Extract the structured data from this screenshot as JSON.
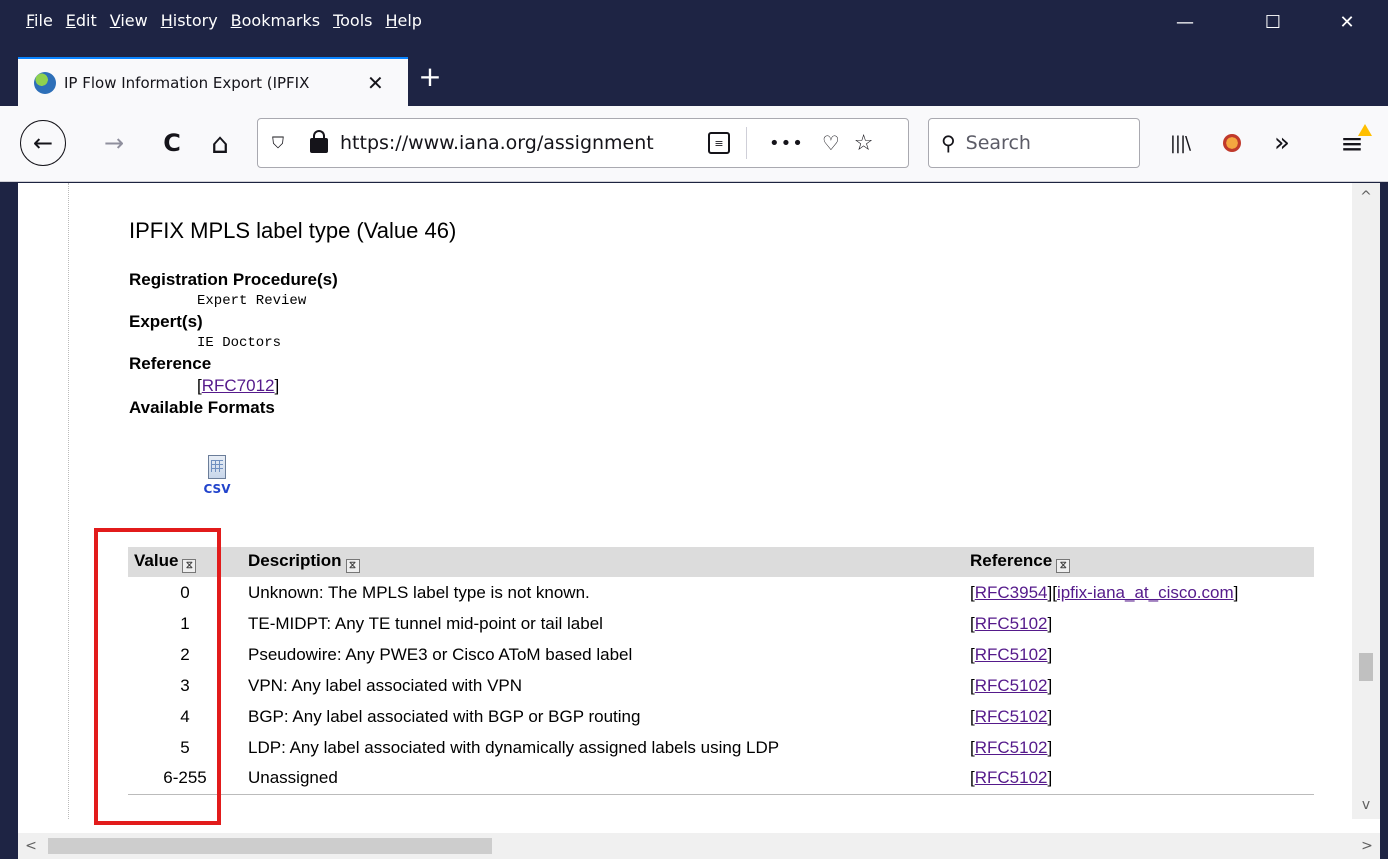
{
  "menubar": {
    "items": [
      "File",
      "Edit",
      "View",
      "History",
      "Bookmarks",
      "Tools",
      "Help"
    ],
    "minimize": "—",
    "maximize": "☐",
    "close": "✕"
  },
  "tab": {
    "title": "IP Flow Information Export (IPFIX",
    "close": "✕",
    "new_tab": "+"
  },
  "nav": {
    "back": "←",
    "forward": "→",
    "reload": "C",
    "home": "⌂",
    "url": "https://www.iana.org/assignment",
    "more": "•••",
    "search_placeholder": "Search",
    "library": "|||\\",
    "overflow": "»",
    "menu": "≡"
  },
  "page": {
    "heading": "IPFIX MPLS label type (Value 46)",
    "registration_label": "Registration Procedure(s)",
    "registration_value": "Expert Review",
    "experts_label": "Expert(s)",
    "experts_value": "IE Doctors",
    "reference_label": "Reference",
    "reference_open": "[",
    "reference_link": "RFC7012",
    "reference_close": "]",
    "formats_label": "Available Formats",
    "csv_label": "CSV"
  },
  "table": {
    "headers": {
      "value": "Value",
      "description": "Description",
      "reference": "Reference"
    },
    "rows": [
      {
        "value": "0",
        "description": "Unknown: The MPLS label type is not known.",
        "ref1": "RFC3954",
        "ref2": "ipfix-iana_at_cisco.com"
      },
      {
        "value": "1",
        "description": "TE-MIDPT: Any TE tunnel mid-point or tail label",
        "ref1": "RFC5102"
      },
      {
        "value": "2",
        "description": "Pseudowire: Any PWE3 or Cisco AToM based label",
        "ref1": "RFC5102"
      },
      {
        "value": "3",
        "description": "VPN: Any label associated with VPN",
        "ref1": "RFC5102"
      },
      {
        "value": "4",
        "description": "BGP: Any label associated with BGP or BGP routing",
        "ref1": "RFC5102"
      },
      {
        "value": "5",
        "description": "LDP: Any label associated with dynamically assigned labels using LDP",
        "ref1": "RFC5102"
      },
      {
        "value": "6-255",
        "description": "Unassigned",
        "ref1": "RFC5102"
      }
    ]
  },
  "colors": {
    "highlight_border": "#e21b1b",
    "link": "#551a8b",
    "chrome_dark": "#1e2444"
  }
}
